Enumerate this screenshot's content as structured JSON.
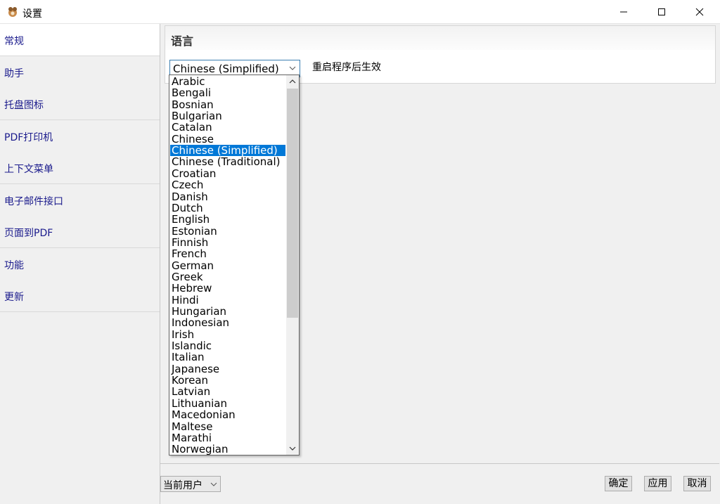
{
  "window": {
    "title": "设置",
    "app_icon": "app-icon",
    "controls": [
      "minimize-icon",
      "maximize-icon",
      "close-icon"
    ]
  },
  "sidebar": {
    "items": [
      {
        "label": "常规",
        "active": true
      },
      {
        "label": "助手"
      },
      {
        "label": "托盘图标"
      },
      {
        "label": "PDF打印机"
      },
      {
        "label": "上下文菜单"
      },
      {
        "label": "电子邮件接口"
      },
      {
        "label": "页面到PDF"
      },
      {
        "label": "功能"
      },
      {
        "label": "更新"
      }
    ]
  },
  "language": {
    "section_title": "语言",
    "selected": "Chinese (Simplified)",
    "note": "重启程序后生效",
    "options": [
      "Arabic",
      "Bengali",
      "Bosnian",
      "Bulgarian",
      "Catalan",
      "Chinese",
      "Chinese (Simplified)",
      "Chinese (Traditional)",
      "Croatian",
      "Czech",
      "Danish",
      "Dutch",
      "English",
      "Estonian",
      "Finnish",
      "French",
      "German",
      "Greek",
      "Hebrew",
      "Hindi",
      "Hungarian",
      "Indonesian",
      "Irish",
      "Islandic",
      "Italian",
      "Japanese",
      "Korean",
      "Latvian",
      "Lithuanian",
      "Macedonian",
      "Maltese",
      "Marathi",
      "Norwegian"
    ],
    "highlighted_index": 6
  },
  "footer": {
    "scope_select": "当前用户",
    "ok": "确定",
    "apply": "应用",
    "cancel": "取消"
  },
  "colors": {
    "selection": "#0078d7",
    "sidebar_text": "#1a1a8c"
  }
}
